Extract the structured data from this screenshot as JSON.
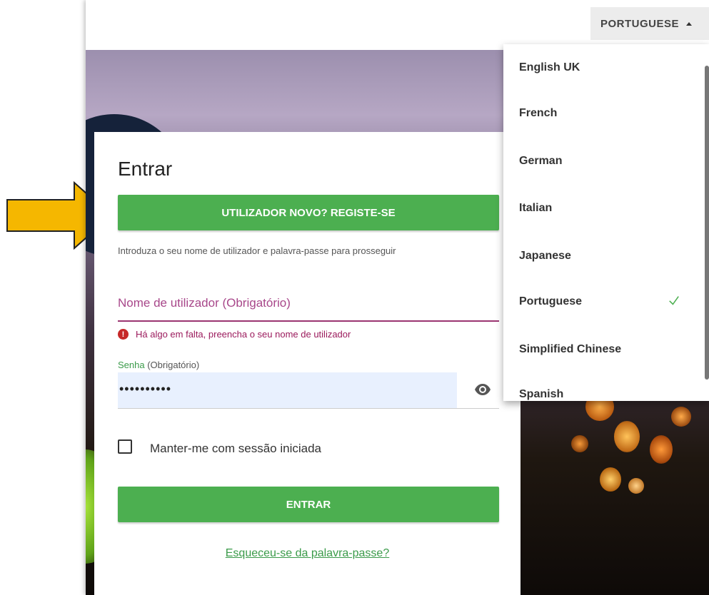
{
  "language_selector": {
    "label": "PORTUGUESE"
  },
  "login": {
    "title": "Entrar",
    "register_button": "UTILIZADOR NOVO? REGISTE-SE",
    "intro_text": "Introduza o seu nome de utilizador e palavra-passe para prosseguir",
    "username_placeholder": "Nome de utilizador  (Obrigatório)",
    "username_error": "Há algo em falta, preencha o seu nome de utilizador",
    "password_label": "Senha",
    "password_required": "(Obrigatório)",
    "password_value": "••••••••••",
    "remember_label": "Manter-me com sessão iniciada",
    "login_button": "ENTRAR",
    "forgot_link": "Esqueceu-se da palavra-passe?"
  },
  "languages": [
    {
      "label": "English UK",
      "selected": false
    },
    {
      "label": "French",
      "selected": false
    },
    {
      "label": "German",
      "selected": false
    },
    {
      "label": "Italian",
      "selected": false
    },
    {
      "label": "Japanese",
      "selected": false
    },
    {
      "label": "Portuguese",
      "selected": true
    },
    {
      "label": "Simplified Chinese",
      "selected": false
    },
    {
      "label": "Spanish",
      "selected": false
    }
  ],
  "colors": {
    "primary_green": "#4caf50",
    "error_accent": "#9b3571",
    "arrow": "#f5b700"
  }
}
